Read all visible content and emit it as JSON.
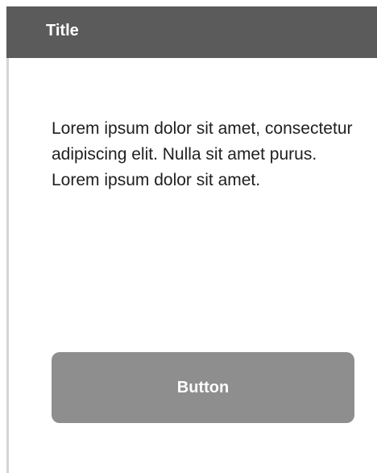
{
  "card": {
    "title": "Title",
    "body": "Lorem ipsum dolor sit amet, consectetur adipiscing elit. Nulla sit amet purus. Lorem ipsum dolor sit amet.",
    "button_label": "Button"
  },
  "colors": {
    "header_background": "#5b5b5b",
    "button_background": "#8e8e8e",
    "text": "#1f1f1f",
    "header_text": "#ffffff",
    "card_border": "#d4d4d4"
  }
}
